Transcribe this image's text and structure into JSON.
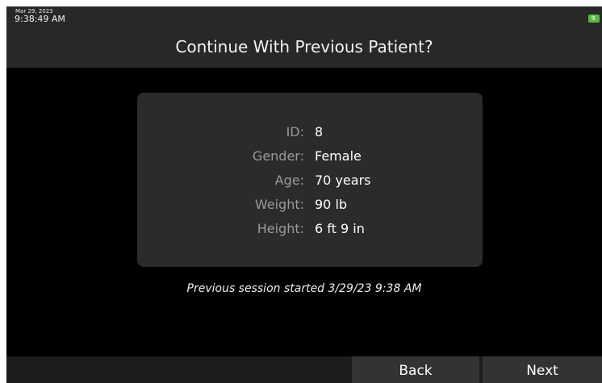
{
  "status": {
    "date": "Mar 29, 2023",
    "time": "9:38:49 AM",
    "battery_color": "#58b947",
    "battery_icon": "battery-charging-icon"
  },
  "title": "Continue With Previous Patient?",
  "patient": [
    {
      "label": "ID:",
      "value": "8"
    },
    {
      "label": "Gender:",
      "value": "Female"
    },
    {
      "label": "Age:",
      "value": "70 years"
    },
    {
      "label": "Weight:",
      "value": "90 lb"
    },
    {
      "label": "Height:",
      "value": "6 ft 9 in"
    }
  ],
  "session_note": "Previous session started 3/29/23 9:38 AM",
  "buttons": {
    "back_label": "Back",
    "next_label": "Next"
  }
}
